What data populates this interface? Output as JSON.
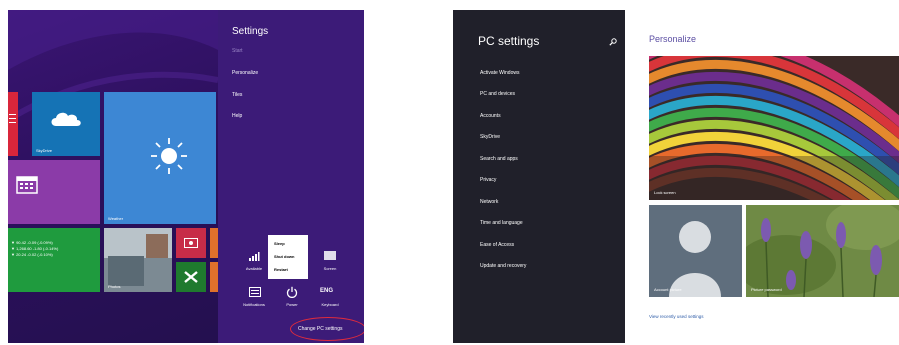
{
  "settings_charm": {
    "title": "Settings",
    "items": [
      "Start",
      "Personalize",
      "Tiles",
      "Help"
    ],
    "quick_settings": [
      {
        "icon": "wifi-signal-icon",
        "label": "Available"
      },
      {
        "icon": "brightness-icon",
        "label": "Screen"
      },
      {
        "icon": "notifications-icon",
        "label": "Notifications"
      },
      {
        "icon": "power-icon",
        "label": "Power"
      },
      {
        "icon": "keyboard-icon",
        "label": "Keyboard",
        "glyph": "ENG"
      }
    ],
    "power_menu": [
      "Sleep",
      "Shut down",
      "Restart"
    ],
    "change_pc_settings": "Change PC settings"
  },
  "start_screen": {
    "tiles": {
      "skydrive": "SkyDrive",
      "weather": "Weather",
      "photos": "Photos",
      "finance_lines": [
        "▼ 90.42 -0.09 (-0.09%)",
        "▼ 1,268.60 -1.80 (-0.14%)",
        "▼ 20.24 -0.02 (-0.10%)"
      ]
    }
  },
  "pc_settings": {
    "title": "PC settings",
    "nav": [
      "Activate Windows",
      "PC and devices",
      "Accounts",
      "SkyDrive",
      "Search and apps",
      "Privacy",
      "Network",
      "Time and language",
      "Ease of Access",
      "Update and recovery"
    ],
    "main": {
      "title": "Personalize",
      "lock_screen_label": "Lock screen",
      "account_picture_label": "Account picture",
      "picture_password_label": "Picture password",
      "recent_link": "View recently used settings"
    }
  },
  "colors": {
    "start_bg": "#2e1161",
    "charm_bg": "#3c1b78",
    "pc_nav_bg": "#20202a",
    "accent_text": "#5c4fa3",
    "highlight_ellipse": "#e02b3c"
  }
}
